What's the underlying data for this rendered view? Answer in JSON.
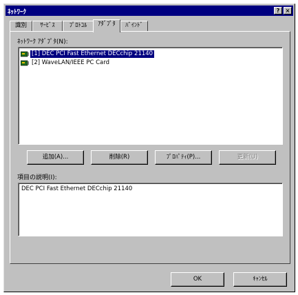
{
  "window": {
    "title": "ﾈｯﾄﾜｰｸ"
  },
  "titlebar_buttons": {
    "help": "?",
    "close": "×"
  },
  "tabs": [
    {
      "label": "識別"
    },
    {
      "label": "ｻｰﾋﾞｽ"
    },
    {
      "label": "ﾌﾟﾛﾄｺﾙ"
    },
    {
      "label": "ｱﾀﾞﾌﾟﾀ",
      "active": true
    },
    {
      "label": "ﾊﾞｲﾝﾄﾞ"
    }
  ],
  "adapters": {
    "label": "ﾈｯﾄﾜｰｸ ｱﾀﾞﾌﾟﾀ(N):",
    "items": [
      {
        "text": "[1] DEC PCI Fast Ethernet DECchip 21140",
        "selected": true,
        "icon": "network-adapter-icon"
      },
      {
        "text": "[2] WaveLAN/IEEE PC Card",
        "selected": false,
        "icon": "network-adapter-icon"
      }
    ]
  },
  "buttons": {
    "add": "追加(A)...",
    "remove": "削除(R)",
    "properties": "ﾌﾟﾛﾊﾟﾃｨ(P)...",
    "update": "更新(U)"
  },
  "description": {
    "label": "項目の説明(I):",
    "text": "DEC PCI Fast Ethernet DECchip 21140"
  },
  "dialog_buttons": {
    "ok": "OK",
    "cancel": "ｷｬﾝｾﾙ"
  },
  "colors": {
    "title_bar": "#000080",
    "face": "#c0c0c0",
    "selection": "#000080"
  }
}
